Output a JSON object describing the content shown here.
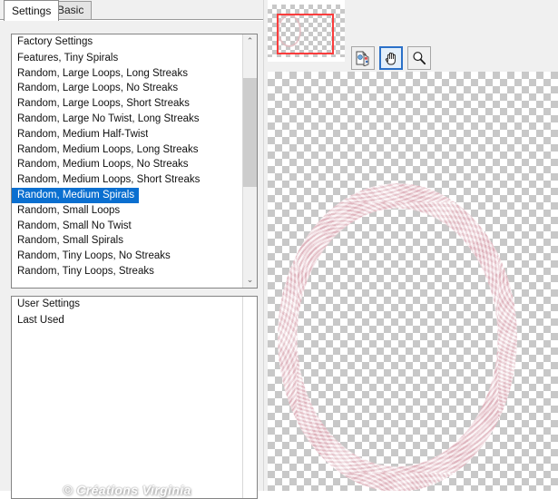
{
  "window": {
    "title": "Settings"
  },
  "tabs": [
    {
      "label": "Settings",
      "active": true
    },
    {
      "label": "Basic",
      "active": false
    }
  ],
  "factory_list": {
    "header": "Factory Settings",
    "selected_index": 9,
    "items": [
      "Features, Tiny Spirals",
      "Random, Large Loops, Long Streaks",
      "Random, Large Loops, No Streaks",
      "Random, Large Loops, Short Streaks",
      "Random, Large No Twist, Long Streaks",
      "Random, Medium Half-Twist",
      "Random, Medium Loops, Long Streaks",
      "Random, Medium Loops, No Streaks",
      "Random, Medium Loops, Short Streaks",
      "Random, Medium Spirals",
      "Random, Small Loops",
      "Random, Small No Twist",
      "Random, Small Spirals",
      "Random, Tiny Loops, No Streaks",
      "Random, Tiny Loops, Streaks"
    ],
    "scroll_up_glyph": "⌃",
    "scroll_down_glyph": "⌄"
  },
  "user_list": {
    "header": "User Settings",
    "items": [
      "Last Used"
    ]
  },
  "watermark": {
    "text": "© Créations Virginia"
  },
  "preview": {
    "toolbar": [
      {
        "name": "auto-proof-button",
        "label": "Auto Proof",
        "selected": false
      },
      {
        "name": "pan-button",
        "label": "Pan",
        "selected": true
      },
      {
        "name": "zoom-button",
        "label": "Zoom",
        "selected": false
      }
    ],
    "navigator": {
      "selection_label": "Navigator selection"
    }
  },
  "colors": {
    "selection_blue": "#0a6fd0",
    "navigator_red": "#fa3c3c",
    "tool_selected_border": "#2a70c8",
    "panel_bg": "#f0f0f0",
    "listbox_bg": "#ffffff",
    "frame_rose": "#e3b3bf",
    "checker_gray": "#c8c8c8"
  }
}
